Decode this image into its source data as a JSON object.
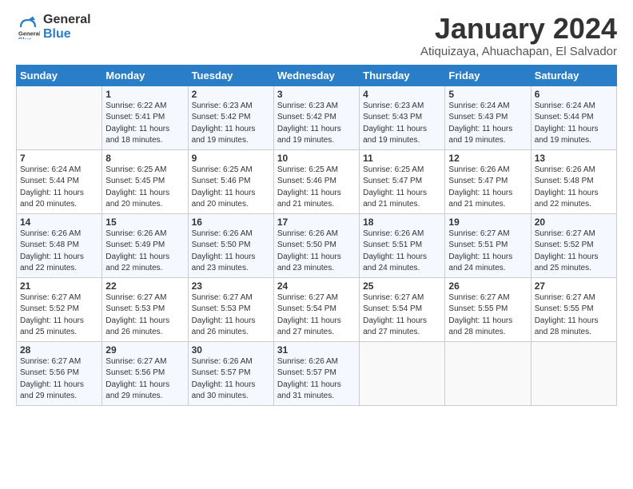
{
  "header": {
    "logo_general": "General",
    "logo_blue": "Blue",
    "month_title": "January 2024",
    "subtitle": "Atiquizaya, Ahuachapan, El Salvador"
  },
  "weekdays": [
    "Sunday",
    "Monday",
    "Tuesday",
    "Wednesday",
    "Thursday",
    "Friday",
    "Saturday"
  ],
  "weeks": [
    [
      {
        "day": "",
        "sunrise": "",
        "sunset": "",
        "daylight": ""
      },
      {
        "day": "1",
        "sunrise": "Sunrise: 6:22 AM",
        "sunset": "Sunset: 5:41 PM",
        "daylight": "Daylight: 11 hours and 18 minutes."
      },
      {
        "day": "2",
        "sunrise": "Sunrise: 6:23 AM",
        "sunset": "Sunset: 5:42 PM",
        "daylight": "Daylight: 11 hours and 19 minutes."
      },
      {
        "day": "3",
        "sunrise": "Sunrise: 6:23 AM",
        "sunset": "Sunset: 5:42 PM",
        "daylight": "Daylight: 11 hours and 19 minutes."
      },
      {
        "day": "4",
        "sunrise": "Sunrise: 6:23 AM",
        "sunset": "Sunset: 5:43 PM",
        "daylight": "Daylight: 11 hours and 19 minutes."
      },
      {
        "day": "5",
        "sunrise": "Sunrise: 6:24 AM",
        "sunset": "Sunset: 5:43 PM",
        "daylight": "Daylight: 11 hours and 19 minutes."
      },
      {
        "day": "6",
        "sunrise": "Sunrise: 6:24 AM",
        "sunset": "Sunset: 5:44 PM",
        "daylight": "Daylight: 11 hours and 19 minutes."
      }
    ],
    [
      {
        "day": "7",
        "sunrise": "Sunrise: 6:24 AM",
        "sunset": "Sunset: 5:44 PM",
        "daylight": "Daylight: 11 hours and 20 minutes."
      },
      {
        "day": "8",
        "sunrise": "Sunrise: 6:25 AM",
        "sunset": "Sunset: 5:45 PM",
        "daylight": "Daylight: 11 hours and 20 minutes."
      },
      {
        "day": "9",
        "sunrise": "Sunrise: 6:25 AM",
        "sunset": "Sunset: 5:46 PM",
        "daylight": "Daylight: 11 hours and 20 minutes."
      },
      {
        "day": "10",
        "sunrise": "Sunrise: 6:25 AM",
        "sunset": "Sunset: 5:46 PM",
        "daylight": "Daylight: 11 hours and 21 minutes."
      },
      {
        "day": "11",
        "sunrise": "Sunrise: 6:25 AM",
        "sunset": "Sunset: 5:47 PM",
        "daylight": "Daylight: 11 hours and 21 minutes."
      },
      {
        "day": "12",
        "sunrise": "Sunrise: 6:26 AM",
        "sunset": "Sunset: 5:47 PM",
        "daylight": "Daylight: 11 hours and 21 minutes."
      },
      {
        "day": "13",
        "sunrise": "Sunrise: 6:26 AM",
        "sunset": "Sunset: 5:48 PM",
        "daylight": "Daylight: 11 hours and 22 minutes."
      }
    ],
    [
      {
        "day": "14",
        "sunrise": "Sunrise: 6:26 AM",
        "sunset": "Sunset: 5:48 PM",
        "daylight": "Daylight: 11 hours and 22 minutes."
      },
      {
        "day": "15",
        "sunrise": "Sunrise: 6:26 AM",
        "sunset": "Sunset: 5:49 PM",
        "daylight": "Daylight: 11 hours and 22 minutes."
      },
      {
        "day": "16",
        "sunrise": "Sunrise: 6:26 AM",
        "sunset": "Sunset: 5:50 PM",
        "daylight": "Daylight: 11 hours and 23 minutes."
      },
      {
        "day": "17",
        "sunrise": "Sunrise: 6:26 AM",
        "sunset": "Sunset: 5:50 PM",
        "daylight": "Daylight: 11 hours and 23 minutes."
      },
      {
        "day": "18",
        "sunrise": "Sunrise: 6:26 AM",
        "sunset": "Sunset: 5:51 PM",
        "daylight": "Daylight: 11 hours and 24 minutes."
      },
      {
        "day": "19",
        "sunrise": "Sunrise: 6:27 AM",
        "sunset": "Sunset: 5:51 PM",
        "daylight": "Daylight: 11 hours and 24 minutes."
      },
      {
        "day": "20",
        "sunrise": "Sunrise: 6:27 AM",
        "sunset": "Sunset: 5:52 PM",
        "daylight": "Daylight: 11 hours and 25 minutes."
      }
    ],
    [
      {
        "day": "21",
        "sunrise": "Sunrise: 6:27 AM",
        "sunset": "Sunset: 5:52 PM",
        "daylight": "Daylight: 11 hours and 25 minutes."
      },
      {
        "day": "22",
        "sunrise": "Sunrise: 6:27 AM",
        "sunset": "Sunset: 5:53 PM",
        "daylight": "Daylight: 11 hours and 26 minutes."
      },
      {
        "day": "23",
        "sunrise": "Sunrise: 6:27 AM",
        "sunset": "Sunset: 5:53 PM",
        "daylight": "Daylight: 11 hours and 26 minutes."
      },
      {
        "day": "24",
        "sunrise": "Sunrise: 6:27 AM",
        "sunset": "Sunset: 5:54 PM",
        "daylight": "Daylight: 11 hours and 27 minutes."
      },
      {
        "day": "25",
        "sunrise": "Sunrise: 6:27 AM",
        "sunset": "Sunset: 5:54 PM",
        "daylight": "Daylight: 11 hours and 27 minutes."
      },
      {
        "day": "26",
        "sunrise": "Sunrise: 6:27 AM",
        "sunset": "Sunset: 5:55 PM",
        "daylight": "Daylight: 11 hours and 28 minutes."
      },
      {
        "day": "27",
        "sunrise": "Sunrise: 6:27 AM",
        "sunset": "Sunset: 5:55 PM",
        "daylight": "Daylight: 11 hours and 28 minutes."
      }
    ],
    [
      {
        "day": "28",
        "sunrise": "Sunrise: 6:27 AM",
        "sunset": "Sunset: 5:56 PM",
        "daylight": "Daylight: 11 hours and 29 minutes."
      },
      {
        "day": "29",
        "sunrise": "Sunrise: 6:27 AM",
        "sunset": "Sunset: 5:56 PM",
        "daylight": "Daylight: 11 hours and 29 minutes."
      },
      {
        "day": "30",
        "sunrise": "Sunrise: 6:26 AM",
        "sunset": "Sunset: 5:57 PM",
        "daylight": "Daylight: 11 hours and 30 minutes."
      },
      {
        "day": "31",
        "sunrise": "Sunrise: 6:26 AM",
        "sunset": "Sunset: 5:57 PM",
        "daylight": "Daylight: 11 hours and 31 minutes."
      },
      {
        "day": "",
        "sunrise": "",
        "sunset": "",
        "daylight": ""
      },
      {
        "day": "",
        "sunrise": "",
        "sunset": "",
        "daylight": ""
      },
      {
        "day": "",
        "sunrise": "",
        "sunset": "",
        "daylight": ""
      }
    ]
  ]
}
